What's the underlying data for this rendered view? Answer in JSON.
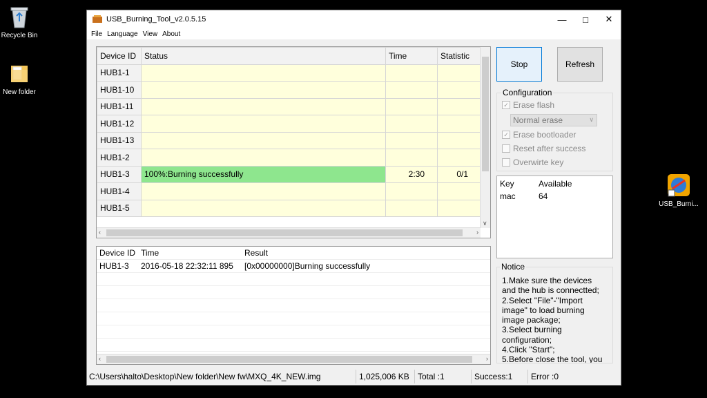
{
  "desktop": {
    "recycle_bin_label": "Recycle Bin",
    "new_folder_label": "New folder",
    "usb_shortcut_label": "USB_Burni..."
  },
  "window": {
    "title": "USB_Burning_Tool_v2.0.5.15",
    "menu": [
      "File",
      "Language",
      "View",
      "About"
    ]
  },
  "device_table": {
    "columns": [
      "Device ID",
      "Status",
      "Time",
      "Statistic"
    ],
    "rows": [
      {
        "id": "HUB1-1",
        "status": "",
        "time": "",
        "stat": ""
      },
      {
        "id": "HUB1-10",
        "status": "",
        "time": "",
        "stat": ""
      },
      {
        "id": "HUB1-11",
        "status": "",
        "time": "",
        "stat": ""
      },
      {
        "id": "HUB1-12",
        "status": "",
        "time": "",
        "stat": ""
      },
      {
        "id": "HUB1-13",
        "status": "",
        "time": "",
        "stat": ""
      },
      {
        "id": "HUB1-2",
        "status": "",
        "time": "",
        "stat": ""
      },
      {
        "id": "HUB1-3",
        "status": "100%:Burning successfully",
        "time": "2:30",
        "stat": "0/1"
      },
      {
        "id": "HUB1-4",
        "status": "",
        "time": "",
        "stat": ""
      },
      {
        "id": "HUB1-5",
        "status": "",
        "time": "",
        "stat": ""
      }
    ]
  },
  "log_table": {
    "columns": [
      "Device ID",
      "Time",
      "Result"
    ],
    "rows": [
      {
        "id": "HUB1-3",
        "time": "2016-05-18 22:32:11 895",
        "result": "[0x00000000]Burning successfully"
      }
    ]
  },
  "buttons": {
    "stop": "Stop",
    "refresh": "Refresh"
  },
  "configuration": {
    "label": "Configuration",
    "erase_flash": "Erase flash",
    "erase_mode": "Normal erase",
    "erase_bootloader": "Erase bootloader",
    "reset_after_success": "Reset after success",
    "overwrite_key": "Overwirte key"
  },
  "key_table": {
    "columns": [
      "Key",
      "Available"
    ],
    "rows": [
      {
        "key": "mac",
        "available": "64"
      }
    ]
  },
  "notice": {
    "label": "Notice",
    "text": "1.Make sure the devices and the hub is connectted;\n2.Select \"File\"-\"Import image\" to load burning image package;\n3.Select burning configuration;\n4.Click \"Start\";\n5.Before close the tool, you"
  },
  "statusbar": {
    "path": "C:\\Users\\halto\\Desktop\\New folder\\New fw\\MXQ_4K_NEW.img",
    "size": "1,025,006 KB",
    "total": "Total :1",
    "success": "Success:1",
    "error": "Error :0"
  }
}
